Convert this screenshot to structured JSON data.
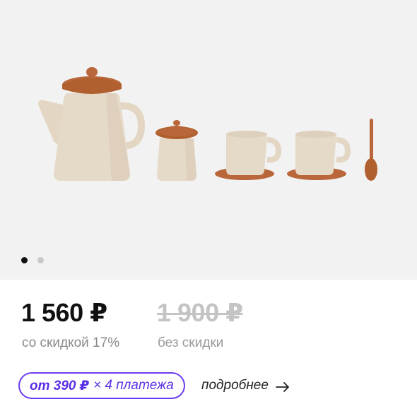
{
  "gallery": {
    "image_alt": "tea set",
    "dots": [
      {
        "active": true
      },
      {
        "active": false
      }
    ]
  },
  "price": {
    "current": "1 560 ₽",
    "old": "1 900 ₽",
    "discount_label": "со скидкой 17%",
    "no_discount_label": "без скидки"
  },
  "installments": {
    "amount": "от 390 ₽",
    "multiplier": "× 4 платежа",
    "more_link": "подробнее"
  },
  "colors": {
    "accent": "#6b3df0",
    "terracotta": "#b8663a",
    "beige": "#e2d5c2"
  },
  "icons": {
    "arrow": "arrow-right-icon"
  }
}
